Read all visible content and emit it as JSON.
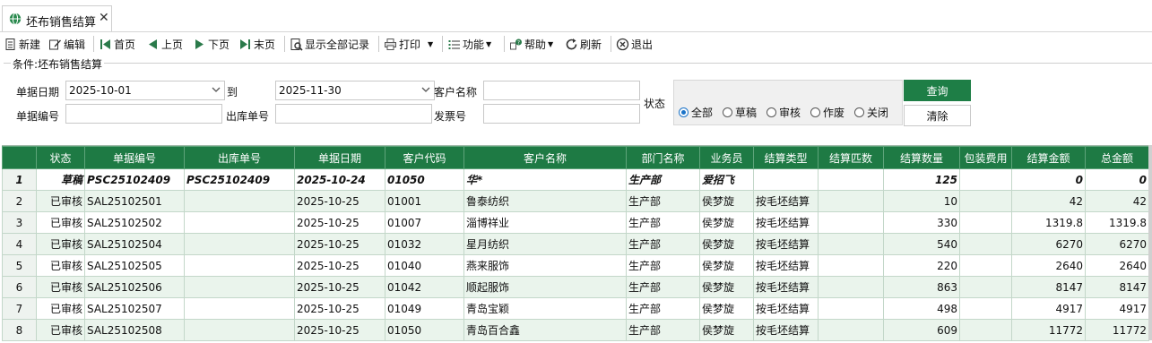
{
  "tab": {
    "title": "坯布销售结算",
    "icon": "globe-icon",
    "close": "✕"
  },
  "toolbar": {
    "new": "新建",
    "edit": "编辑",
    "first": "首页",
    "prev": "上页",
    "next": "下页",
    "last": "末页",
    "show_all": "显示全部记录",
    "print": "打印",
    "function": "功能",
    "help": "帮助",
    "refresh": "刷新",
    "exit": "退出"
  },
  "conditions": {
    "title": "条件:坯布销售结算",
    "date_label": "单据日期",
    "date_from": "2025-10-01",
    "to_label": "到",
    "date_to": "2025-11-30",
    "customer_name_label": "客户名称",
    "customer_name": "",
    "doc_no_label": "单据编号",
    "doc_no": "",
    "outbound_no_label": "出库单号",
    "outbound_no": "",
    "invoice_label": "发票号",
    "invoice_no": "",
    "status_label": "状态",
    "status_options": [
      "全部",
      "草稿",
      "审核",
      "作废",
      "关闭"
    ],
    "status_selected": "全部",
    "query_button": "查询",
    "clear_button": "清除"
  },
  "colors": {
    "header_green": "#1e7a44",
    "query_green": "#1e7e46",
    "row_alt": "#eaf4ec",
    "radio_accent": "#1a73c8"
  },
  "grid": {
    "columns": [
      "状态",
      "单据编号",
      "出库单号",
      "单据日期",
      "客户代码",
      "客户名称",
      "部门名称",
      "业务员",
      "结算类型",
      "结算匹数",
      "结算数量",
      "包装费用",
      "结算金额",
      "总金额"
    ],
    "rows": [
      {
        "no": "1",
        "status": "草稿",
        "doc_no": "PSC25102409",
        "outbound_no": "PSC25102409",
        "date": "2025-10-24",
        "cust_code": "01050",
        "cust_name": "华*",
        "dept": "生产部",
        "salesman": "爱招飞",
        "settle_type": "",
        "pieces": "",
        "qty": "125",
        "pack_fee": "",
        "amount": "0",
        "total": "0",
        "draft": true
      },
      {
        "no": "2",
        "status": "已审核",
        "doc_no": "SAL25102501",
        "outbound_no": "",
        "date": "2025-10-25",
        "cust_code": "01001",
        "cust_name": "鲁泰纺织",
        "dept": "生产部",
        "salesman": "侯梦旋",
        "settle_type": "按毛坯结算",
        "pieces": "",
        "qty": "10",
        "pack_fee": "",
        "amount": "42",
        "total": "42"
      },
      {
        "no": "3",
        "status": "已审核",
        "doc_no": "SAL25102502",
        "outbound_no": "",
        "date": "2025-10-25",
        "cust_code": "01007",
        "cust_name": "淄博祥业",
        "dept": "生产部",
        "salesman": "侯梦旋",
        "settle_type": "按毛坯结算",
        "pieces": "",
        "qty": "330",
        "pack_fee": "",
        "amount": "1319.8",
        "total": "1319.8"
      },
      {
        "no": "4",
        "status": "已审核",
        "doc_no": "SAL25102504",
        "outbound_no": "",
        "date": "2025-10-25",
        "cust_code": "01032",
        "cust_name": "星月纺织",
        "dept": "生产部",
        "salesman": "侯梦旋",
        "settle_type": "按毛坯结算",
        "pieces": "",
        "qty": "540",
        "pack_fee": "",
        "amount": "6270",
        "total": "6270"
      },
      {
        "no": "5",
        "status": "已审核",
        "doc_no": "SAL25102505",
        "outbound_no": "",
        "date": "2025-10-25",
        "cust_code": "01040",
        "cust_name": "燕来服饰",
        "dept": "生产部",
        "salesman": "侯梦旋",
        "settle_type": "按毛坯结算",
        "pieces": "",
        "qty": "220",
        "pack_fee": "",
        "amount": "2640",
        "total": "2640"
      },
      {
        "no": "6",
        "status": "已审核",
        "doc_no": "SAL25102506",
        "outbound_no": "",
        "date": "2025-10-25",
        "cust_code": "01042",
        "cust_name": "顺起服饰",
        "dept": "生产部",
        "salesman": "侯梦旋",
        "settle_type": "按毛坯结算",
        "pieces": "",
        "qty": "863",
        "pack_fee": "",
        "amount": "8147",
        "total": "8147"
      },
      {
        "no": "7",
        "status": "已审核",
        "doc_no": "SAL25102507",
        "outbound_no": "",
        "date": "2025-10-25",
        "cust_code": "01049",
        "cust_name": "青岛宝颖",
        "dept": "生产部",
        "salesman": "侯梦旋",
        "settle_type": "按毛坯结算",
        "pieces": "",
        "qty": "498",
        "pack_fee": "",
        "amount": "4917",
        "total": "4917"
      },
      {
        "no": "8",
        "status": "已审核",
        "doc_no": "SAL25102508",
        "outbound_no": "",
        "date": "2025-10-25",
        "cust_code": "01050",
        "cust_name": "青岛百合鑫",
        "dept": "生产部",
        "salesman": "侯梦旋",
        "settle_type": "按毛坯结算",
        "pieces": "",
        "qty": "609",
        "pack_fee": "",
        "amount": "11772",
        "total": "11772"
      }
    ]
  }
}
